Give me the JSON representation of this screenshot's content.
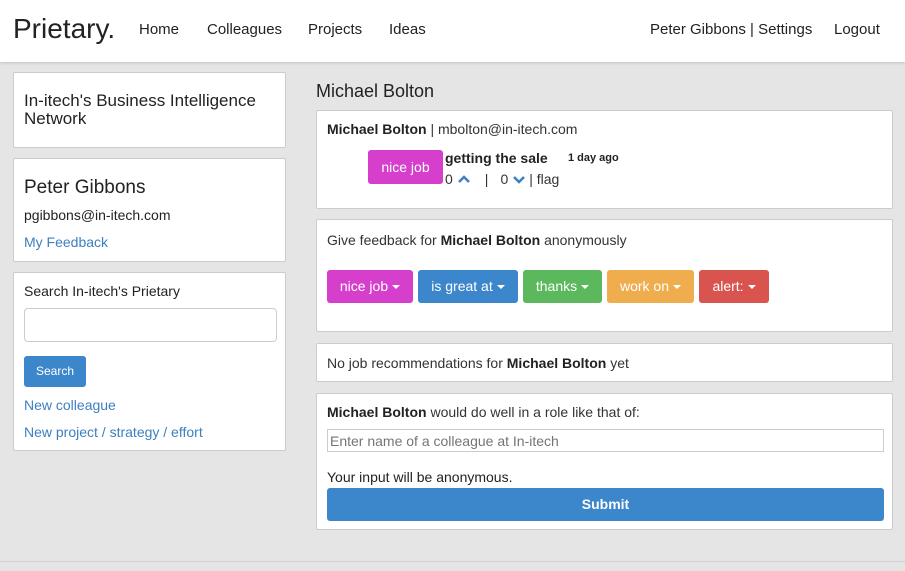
{
  "nav": {
    "brand": "Prietary.",
    "links": [
      "Home",
      "Colleagues",
      "Projects",
      "Ideas"
    ],
    "user_settings": "Peter Gibbons | Settings",
    "logout": "Logout"
  },
  "sidebar": {
    "network_title": "In-itech's Business Intelligence Network",
    "user_name": "Peter Gibbons",
    "user_email": "pgibbons@in-itech.com",
    "my_feedback": "My Feedback",
    "search_label": "Search In-itech's Prietary",
    "search_placeholder": "",
    "search_button": "Search",
    "new_colleague": "New colleague",
    "new_project": "New project / strategy / effort"
  },
  "main": {
    "page_title": "Michael Bolton",
    "profile": {
      "name": "Michael Bolton",
      "separator": "|",
      "email": "mbolton@in-itech.com",
      "feedback": {
        "tag": "nice job",
        "text": "getting the sale",
        "time": "1 day ago",
        "up_count": "0",
        "divider": "|",
        "down_count": "0",
        "flag": "| flag"
      }
    },
    "give_feedback": {
      "prefix": "Give feedback for",
      "name": "Michael Bolton",
      "suffix": "anonymously",
      "buttons": [
        {
          "label": "nice job",
          "color": "#d53fcb"
        },
        {
          "label": "is great at",
          "color": "#3c87cc"
        },
        {
          "label": "thanks",
          "color": "#5cb85c"
        },
        {
          "label": "work on",
          "color": "#f0ad4e"
        },
        {
          "label": "alert:",
          "color": "#d9534f"
        }
      ]
    },
    "recommendations": {
      "prefix": "No job recommendations for",
      "name": "Michael Bolton",
      "suffix": "yet"
    },
    "role": {
      "name": "Michael Bolton",
      "text": "would do well in a role like that of:",
      "placeholder": "Enter name of a colleague at In-itech",
      "note": "Your input will be anonymous.",
      "submit": "Submit"
    }
  }
}
